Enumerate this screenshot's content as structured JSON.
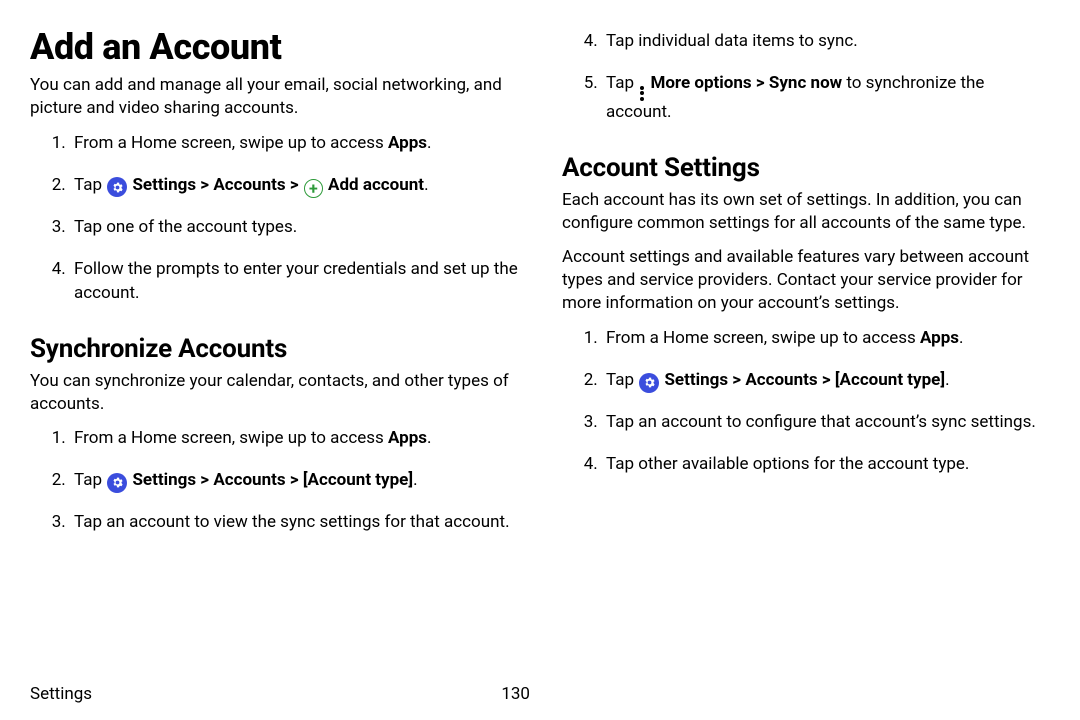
{
  "page": {
    "title": "Add an Account",
    "intro": "You can add and manage all your email, social networking, and picture and video sharing accounts."
  },
  "steps_add": {
    "s1_pre": "From a Home screen, swipe up to access ",
    "s1_bold": "Apps",
    "s1_post": ".",
    "s2_tap": "Tap ",
    "s2_settings": " Settings",
    "s2_sep1": " > ",
    "s2_accounts": "Accounts",
    "s2_sep2": " > ",
    "s2_add": " Add account",
    "s2_end": ".",
    "s3": "Tap one of the account types.",
    "s4": "Follow the prompts to enter your credentials and set up the account."
  },
  "sync": {
    "heading": "Synchronize Accounts",
    "intro": "You can synchronize your calendar, contacts, and other types of accounts.",
    "s1_pre": "From a Home screen, swipe up to access ",
    "s1_bold": "Apps",
    "s1_post": ".",
    "s2_tap": "Tap ",
    "s2_settings": " Settings",
    "s2_sep1": " > ",
    "s2_accounts": "Accounts",
    "s2_sep2": " > ",
    "s2_type": "[Account type]",
    "s2_end": ".",
    "s3": "Tap an account to view the sync settings for that account.",
    "s4": "Tap individual data items to sync.",
    "s5_tap": "Tap ",
    "s5_more": " More options",
    "s5_sep": " > ",
    "s5_sync": "Sync now",
    "s5_post": " to synchronize the account."
  },
  "acct": {
    "heading": "Account Settings",
    "p1": "Each account has its own set of settings. In addition, you can configure common settings for all accounts of the same type.",
    "p2": "Account settings and available features vary between account types and service providers. Contact your service provider for more information on your account’s settings.",
    "s1_pre": "From a Home screen, swipe up to access ",
    "s1_bold": "Apps",
    "s1_post": ".",
    "s2_tap": "Tap ",
    "s2_settings": " Settings",
    "s2_sep1": " > ",
    "s2_accounts": "Accounts",
    "s2_sep2": " > ",
    "s2_type": "[Account type]",
    "s2_end": ".",
    "s3": "Tap an account to configure that account’s sync settings.",
    "s4": "Tap other available options for the account type."
  },
  "footer": {
    "section": "Settings",
    "page_no": "130"
  }
}
